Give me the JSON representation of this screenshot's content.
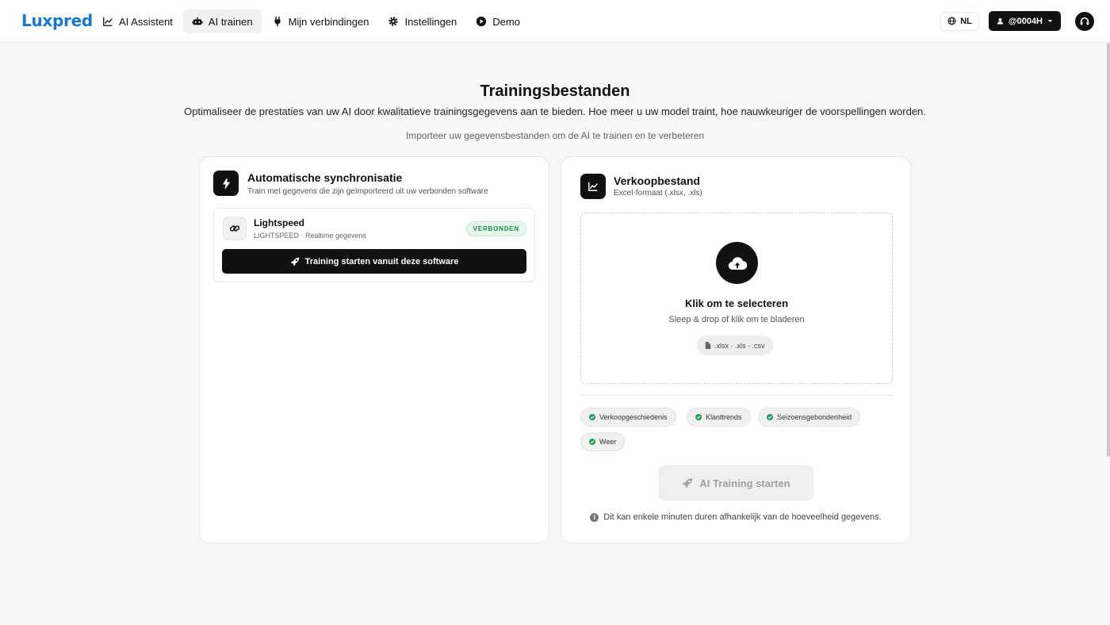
{
  "app": {
    "logo": "Luxpred"
  },
  "nav": [
    {
      "label": "AI Assistent",
      "icon": "chart-line-icon",
      "active": false
    },
    {
      "label": "AI trainen",
      "icon": "robot-icon",
      "active": true
    },
    {
      "label": "Mijn verbindingen",
      "icon": "plug-icon",
      "active": false
    },
    {
      "label": "Instellingen",
      "icon": "gear-icon",
      "active": false
    },
    {
      "label": "Demo",
      "icon": "play-circle-icon",
      "active": false
    }
  ],
  "header_tools": {
    "language": "NL",
    "user": "@0004H"
  },
  "page": {
    "title": "Trainingsbestanden",
    "subtitle": "Optimaliseer de prestaties van uw AI door kwalitatieve trainingsgegevens aan te bieden. Hoe meer u uw model traint, hoe nauwkeuriger de voorspellingen worden.",
    "hint": "Importeer uw gegevensbestanden om de AI te trainen en te verbeteren"
  },
  "sync_card": {
    "title": "Automatische synchronisatie",
    "subtitle": "Train met gegevens die zijn geïmporteerd uit uw verbonden software",
    "integration": {
      "name": "Lightspeed",
      "meta": "LIGHTSPEED · Realtime gegevens",
      "status": "VERBONDEN",
      "button": "Training starten vanuit deze software"
    }
  },
  "file_card": {
    "title": "Verkoopbestand",
    "subtitle": "Excel-formaat (.xlsx, .xls)",
    "dropzone": {
      "title": "Klik om te selecteren",
      "subtitle": "Sleep & drop of klik om te bladeren",
      "formats": ".xlsx · .xls · .csv"
    },
    "chips": [
      "Verkoopgeschiedenis",
      "Klanttrends",
      "Seizoensgebondenheid",
      "Weer"
    ],
    "train_button": "AI Training starten",
    "note": "Dit kan enkele minuten duren afhankelijk van de hoeveelheid gegevens."
  },
  "colors": {
    "brand": "#1a78c9",
    "connected": "#1a8a4a",
    "dark": "#111111"
  }
}
